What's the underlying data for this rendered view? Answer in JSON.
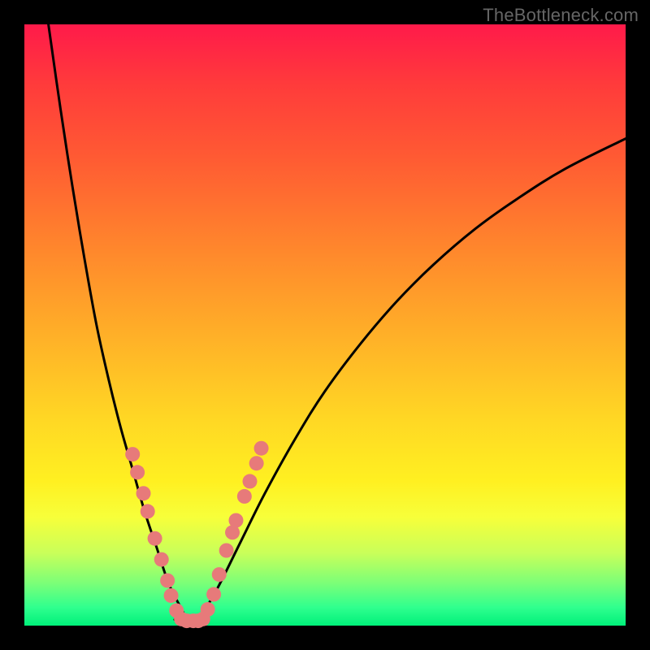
{
  "watermark": {
    "text": "TheBottleneck.com"
  },
  "chart_data": {
    "type": "line",
    "title": "",
    "xlabel": "",
    "ylabel": "",
    "xlim": [
      0,
      100
    ],
    "ylim": [
      0,
      100
    ],
    "series": [
      {
        "name": "left-curve",
        "x": [
          4,
          6,
          8,
          10,
          12,
          14,
          16,
          18,
          20,
          22,
          24,
          26,
          27
        ],
        "values": [
          100,
          86,
          73,
          61,
          50,
          41,
          33,
          26,
          19,
          13,
          7,
          3,
          1
        ]
      },
      {
        "name": "right-curve",
        "x": [
          29,
          32,
          36,
          40,
          45,
          50,
          56,
          62,
          68,
          75,
          82,
          90,
          100
        ],
        "values": [
          1,
          6,
          14,
          22,
          31,
          39,
          47,
          54,
          60,
          66,
          71,
          76,
          81
        ]
      },
      {
        "name": "bottom-flat",
        "x": [
          25,
          26,
          27,
          28,
          29,
          30
        ],
        "values": [
          1,
          0.5,
          0.5,
          0.5,
          0.5,
          1
        ]
      }
    ],
    "dots": {
      "name": "markers",
      "color": "#e77a7a",
      "radius": 9,
      "points": [
        {
          "x": 18.0,
          "y": 28.5
        },
        {
          "x": 18.8,
          "y": 25.5
        },
        {
          "x": 19.8,
          "y": 22.0
        },
        {
          "x": 20.5,
          "y": 19.0
        },
        {
          "x": 21.7,
          "y": 14.5
        },
        {
          "x": 22.8,
          "y": 11.0
        },
        {
          "x": 23.8,
          "y": 7.5
        },
        {
          "x": 24.4,
          "y": 5.0
        },
        {
          "x": 25.3,
          "y": 2.5
        },
        {
          "x": 26.1,
          "y": 1.1
        },
        {
          "x": 27.0,
          "y": 0.8
        },
        {
          "x": 28.1,
          "y": 0.8
        },
        {
          "x": 28.9,
          "y": 0.8
        },
        {
          "x": 29.7,
          "y": 1.1
        },
        {
          "x": 30.5,
          "y": 2.7
        },
        {
          "x": 31.5,
          "y": 5.2
        },
        {
          "x": 32.4,
          "y": 8.5
        },
        {
          "x": 33.6,
          "y": 12.5
        },
        {
          "x": 34.6,
          "y": 15.5
        },
        {
          "x": 35.2,
          "y": 17.5
        },
        {
          "x": 36.6,
          "y": 21.5
        },
        {
          "x": 37.5,
          "y": 24.0
        },
        {
          "x": 38.6,
          "y": 27.0
        },
        {
          "x": 39.4,
          "y": 29.5
        }
      ]
    }
  }
}
